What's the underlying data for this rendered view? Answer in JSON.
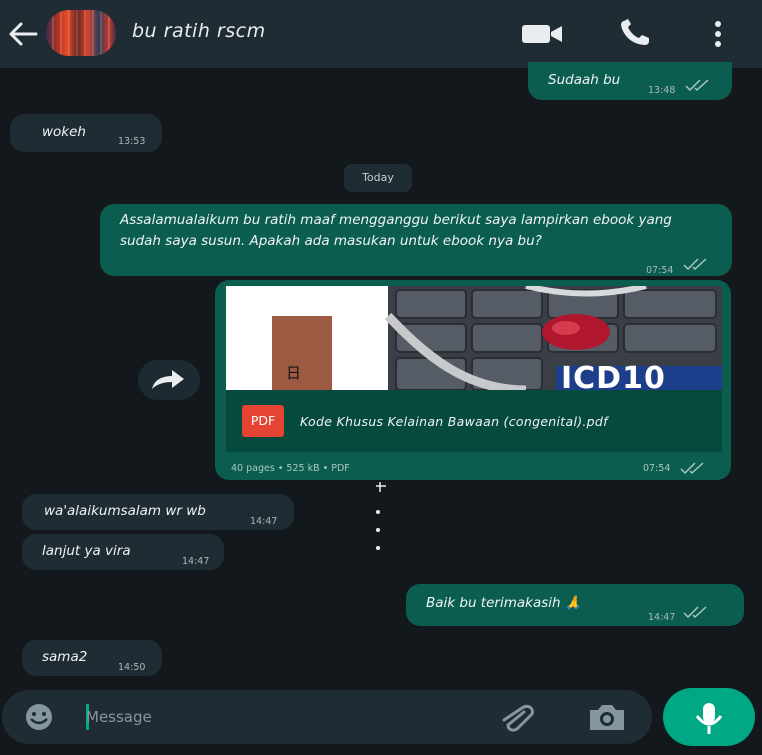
{
  "header": {
    "contact_name": "bu ratih rscm",
    "icons": [
      "back-arrow-icon",
      "video-call-icon",
      "phone-icon",
      "more-options-icon"
    ]
  },
  "messages": [
    {
      "dir": "out",
      "text": "Sudaah bu",
      "time": "13:48",
      "ticks": "read"
    },
    {
      "dir": "in",
      "text": "wokeh",
      "time": "13:53"
    },
    {
      "dir": "out",
      "text": "Assalamualaikum bu ratih maaf mengganggu berikut saya lampirkan ebook yang sudah saya susun. Apakah ada masukan untuk ebook nya bu?",
      "time": "07:54",
      "ticks": "read"
    },
    {
      "dir": "in",
      "text": "wa'alaikumsalam wr wb",
      "time": "14:47"
    },
    {
      "dir": "in",
      "text": "lanjut ya vira",
      "time": "14:47"
    },
    {
      "dir": "out",
      "text": "Baik bu terimakasih 🙏",
      "time": "14:47",
      "ticks": "read"
    },
    {
      "dir": "in",
      "text": "sama2",
      "time": "14:50"
    }
  ],
  "date_divider": "Today",
  "document": {
    "badge": "PDF",
    "filename": "Kode Khusus Kelainan Bawaan (congenital).pdf",
    "meta": "40 pages • 525 kB • PDF",
    "time": "07:54",
    "thumbnail_text": "ICD10",
    "thumbnail_symbol": "日"
  },
  "composer": {
    "placeholder": "Message",
    "icons": [
      "emoji-icon",
      "attachment-icon",
      "camera-icon",
      "mic-icon"
    ]
  },
  "colors": {
    "header_bg": "#1f2c34",
    "incoming_bubble": "#1f2c34",
    "outgoing_bubble": "#0b5e4f",
    "accent": "#00a884",
    "pdf_red": "#e54435"
  }
}
